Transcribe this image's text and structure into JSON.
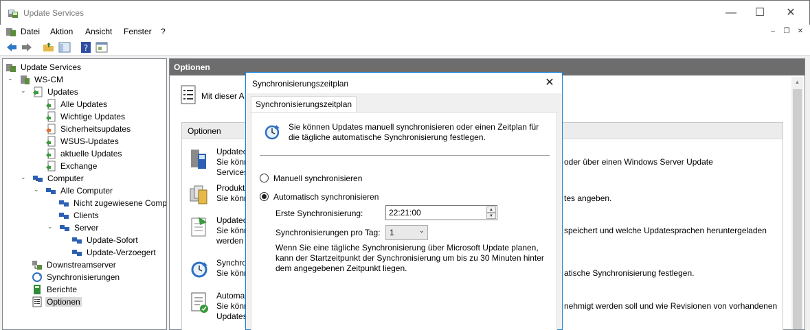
{
  "window": {
    "title": "Update Services",
    "minimize": "—",
    "maximize": "☐",
    "close": "✕"
  },
  "menu": {
    "items": [
      "Datei",
      "Aktion",
      "Ansicht",
      "Fenster",
      "?"
    ],
    "mdi_min": "–",
    "mdi_restore": "❐",
    "mdi_close": "✕"
  },
  "tree": {
    "root": "Update Services",
    "server": "WS-CM",
    "updates": "Updates",
    "update_children": [
      "Alle Updates",
      "Wichtige Updates",
      "Sicherheitsupdates",
      "WSUS-Updates",
      "aktuelle Updates",
      "Exchange"
    ],
    "computer": "Computer",
    "alle_computer": "Alle Computer",
    "nicht_zugewiesen": "Nicht zugewiesene Comp",
    "clients": "Clients",
    "server_group": "Server",
    "server_children": [
      "Update-Sofort",
      "Update-Verzoegert"
    ],
    "downstream": "Downstreamserver",
    "sync": "Synchronisierungen",
    "reports": "Berichte",
    "options": "Optionen"
  },
  "main": {
    "header": "Optionen",
    "intro": "Mit dieser A",
    "panel_title": "Optionen",
    "items": [
      {
        "left": [
          "Updatec",
          "Sie könn",
          "Services"
        ],
        "right": "oder über einen Windows Server Update"
      },
      {
        "left": [
          "Produkt",
          "Sie könn"
        ],
        "right": "tes angeben."
      },
      {
        "left": [
          "Updatec",
          "Sie könn",
          "werden"
        ],
        "right": "speichert und welche Updatesprachen heruntergeladen"
      },
      {
        "left": [
          "Synchro",
          "Sie könn"
        ],
        "right": "atische Synchronisierung festlegen."
      },
      {
        "left": [
          "Automa",
          "Sie könn",
          "Updates"
        ],
        "right": "nehmigt werden soll und wie Revisionen von vorhandenen"
      }
    ]
  },
  "dialog": {
    "title": "Synchronisierungszeitplan",
    "close": "✕",
    "tab": "Synchronisierungszeitplan",
    "description": "Sie können Updates manuell synchronisieren oder einen Zeitplan für die tägliche automatische Synchronisierung festlegen.",
    "radio_manual": "Manuell synchronisieren",
    "radio_auto": "Automatisch synchronisieren",
    "selected": "auto",
    "first_sync_label": "Erste Synchronisierung:",
    "first_sync_value": "22:21:00",
    "per_day_label": "Synchronisierungen pro Tag:",
    "per_day_value": "1",
    "note": "Wenn Sie eine tägliche Synchronisierung über Microsoft Update planen, kann der Startzeitpunkt der Synchronisierung um bis zu 30 Minuten hinter dem angegebenen Zeitpunkt liegen."
  }
}
